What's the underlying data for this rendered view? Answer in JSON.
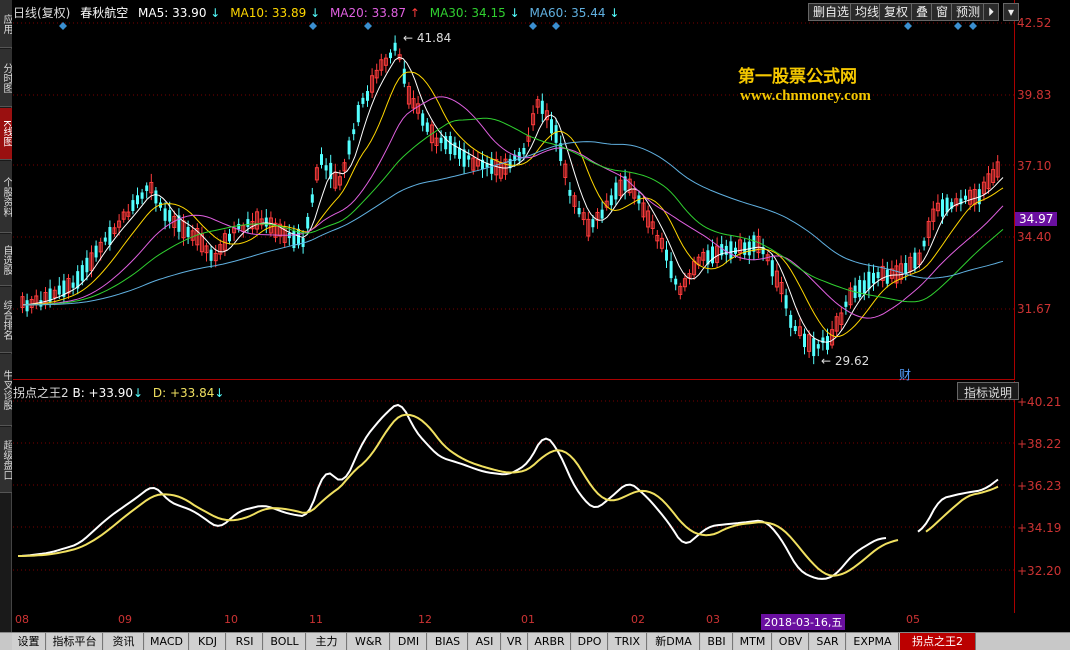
{
  "left_tabs": [
    {
      "label": "应用",
      "active": false
    },
    {
      "label": "分时图",
      "active": false
    },
    {
      "label": "K线图",
      "active": true
    },
    {
      "label": "个股资料",
      "active": false
    },
    {
      "label": "自选股",
      "active": false
    },
    {
      "label": "综合排名",
      "active": false
    },
    {
      "label": "牛叉诊股",
      "active": false
    },
    {
      "label": "超级盘口",
      "active": false
    }
  ],
  "header": {
    "period": "日线(复权)",
    "stock_name": "春秋航空",
    "ma5": "MA5: 33.90",
    "ma10": "MA10: 33.89",
    "ma20": "MA20: 33.87",
    "ma30": "MA30: 34.15",
    "ma60": "MA60: 35.44",
    "ma5_arrow": "↓",
    "ma10_arrow": "↓",
    "ma20_arrow": "↑",
    "ma30_arrow": "↓",
    "ma60_arrow": "↓"
  },
  "toolbar": {
    "delete_watch": "删自选",
    "line_type": "均线",
    "adjust": "复权",
    "overlay": "叠",
    "window": "窗",
    "forecast": "预测",
    "arrow_btn": "⏵",
    "menu_btn": "▾"
  },
  "price_axis": [
    "42.52",
    "39.83",
    "37.10",
    "34.40",
    "31.67"
  ],
  "current_price": "34.97",
  "high_label": "41.84",
  "low_label": "29.62",
  "finance_mark": "财",
  "watermark": {
    "line1": "第一股票公式网",
    "line2": "www.chnmoney.com"
  },
  "indicator": {
    "name": "拐点之王2",
    "b_value": "B: +33.90",
    "b_arrow": "↓",
    "d_value": "D: +33.84",
    "d_arrow": "↓",
    "help": "指标说明",
    "axis": [
      "+40.21",
      "+38.22",
      "+36.23",
      "+34.19",
      "+32.20"
    ]
  },
  "months": [
    "08",
    "09",
    "10",
    "11",
    "12",
    "01",
    "02",
    "03",
    "05"
  ],
  "cursor_date": "2018-03-16,五",
  "bottom_tabs": [
    {
      "label": "设置",
      "active": false
    },
    {
      "label": "指标平台",
      "active": false
    },
    {
      "label": "资讯",
      "active": false
    },
    {
      "label": "MACD",
      "active": false
    },
    {
      "label": "KDJ",
      "active": false
    },
    {
      "label": "RSI",
      "active": false
    },
    {
      "label": "BOLL",
      "active": false
    },
    {
      "label": "主力",
      "active": false
    },
    {
      "label": "W&R",
      "active": false
    },
    {
      "label": "DMI",
      "active": false
    },
    {
      "label": "BIAS",
      "active": false
    },
    {
      "label": "ASI",
      "active": false
    },
    {
      "label": "VR",
      "active": false
    },
    {
      "label": "ARBR",
      "active": false
    },
    {
      "label": "DPO",
      "active": false
    },
    {
      "label": "TRIX",
      "active": false
    },
    {
      "label": "新DMA",
      "active": false
    },
    {
      "label": "BBI",
      "active": false
    },
    {
      "label": "MTM",
      "active": false
    },
    {
      "label": "OBV",
      "active": false
    },
    {
      "label": "SAR",
      "active": false
    },
    {
      "label": "EXPMA",
      "active": false
    },
    {
      "label": "拐点之王2",
      "active": true
    }
  ],
  "colors": {
    "up": "#ff3c3c",
    "down": "#54ffff",
    "ma5": "#ffffff",
    "ma10": "#ffd700",
    "ma20": "#e060e0",
    "ma30": "#30d030",
    "ma60": "#60b0e0",
    "ind_b": "#ffffff",
    "ind_d": "#f0e060",
    "grid": "#7a0000"
  }
}
